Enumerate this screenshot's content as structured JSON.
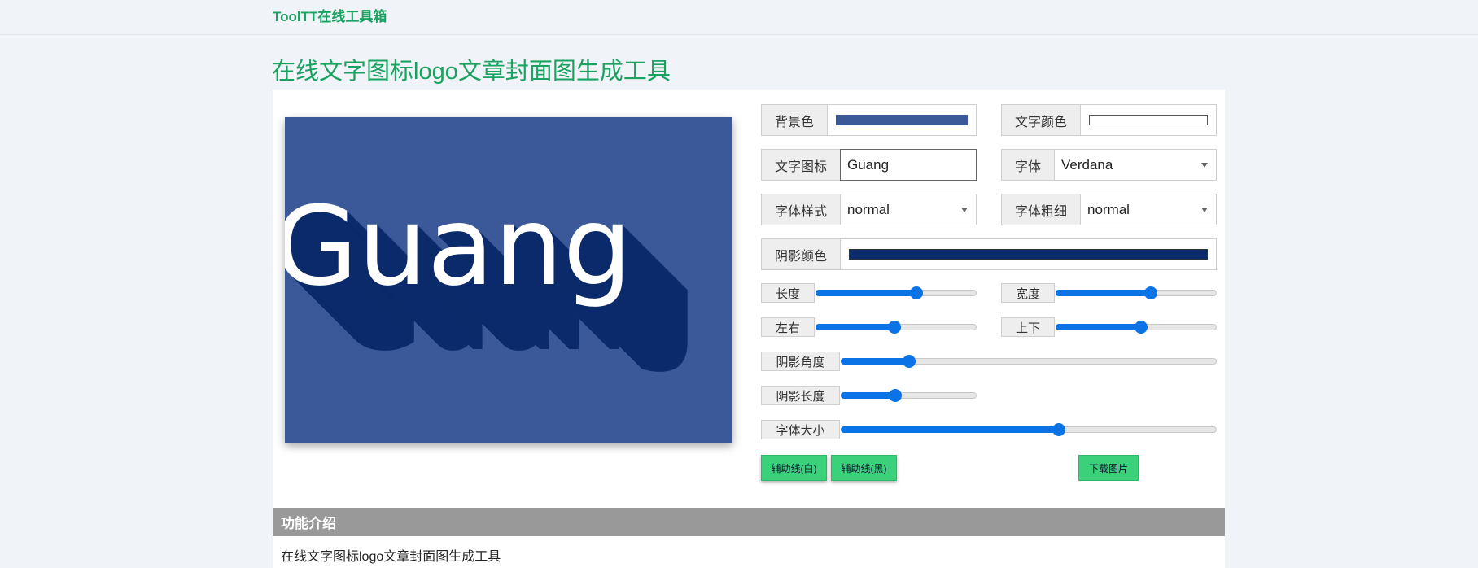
{
  "brand": "ToolTT在线工具箱",
  "page_title": "在线文字图标logo文章封面图生成工具",
  "colors": {
    "accent": "#1aa260",
    "background": "#3b5998",
    "text": "#ffffff",
    "shadow": "#0b2a6b",
    "slider": "#0b73e5",
    "button": "#3ad17a"
  },
  "preview": {
    "text": "Guang"
  },
  "form": {
    "bg_color_label": "背景色",
    "text_color_label": "文字颜色",
    "icon_text_label": "文字图标",
    "icon_text_value": "Guang",
    "font_label": "字体",
    "font_value": "Verdana",
    "font_style_label": "字体样式",
    "font_style_value": "normal",
    "font_weight_label": "字体粗细",
    "font_weight_value": "normal",
    "shadow_color_label": "阴影颜色"
  },
  "sliders": {
    "length": {
      "label": "长度",
      "value": 0.63
    },
    "width": {
      "label": "宽度",
      "value": 0.59
    },
    "horizontal": {
      "label": "左右",
      "value": 0.49
    },
    "vertical": {
      "label": "上下",
      "value": 0.53
    },
    "shadow_angle": {
      "label": "阴影角度",
      "value": 0.18
    },
    "shadow_length": {
      "label": "阴影长度",
      "value": 0.4
    },
    "font_size": {
      "label": "字体大小",
      "value": 0.58
    }
  },
  "buttons": {
    "guide_white": "辅助线(白)",
    "guide_black": "辅助线(黑)",
    "download": "下载图片"
  },
  "intro": {
    "heading": "功能介绍",
    "text": "在线文字图标logo文章封面图生成工具"
  }
}
